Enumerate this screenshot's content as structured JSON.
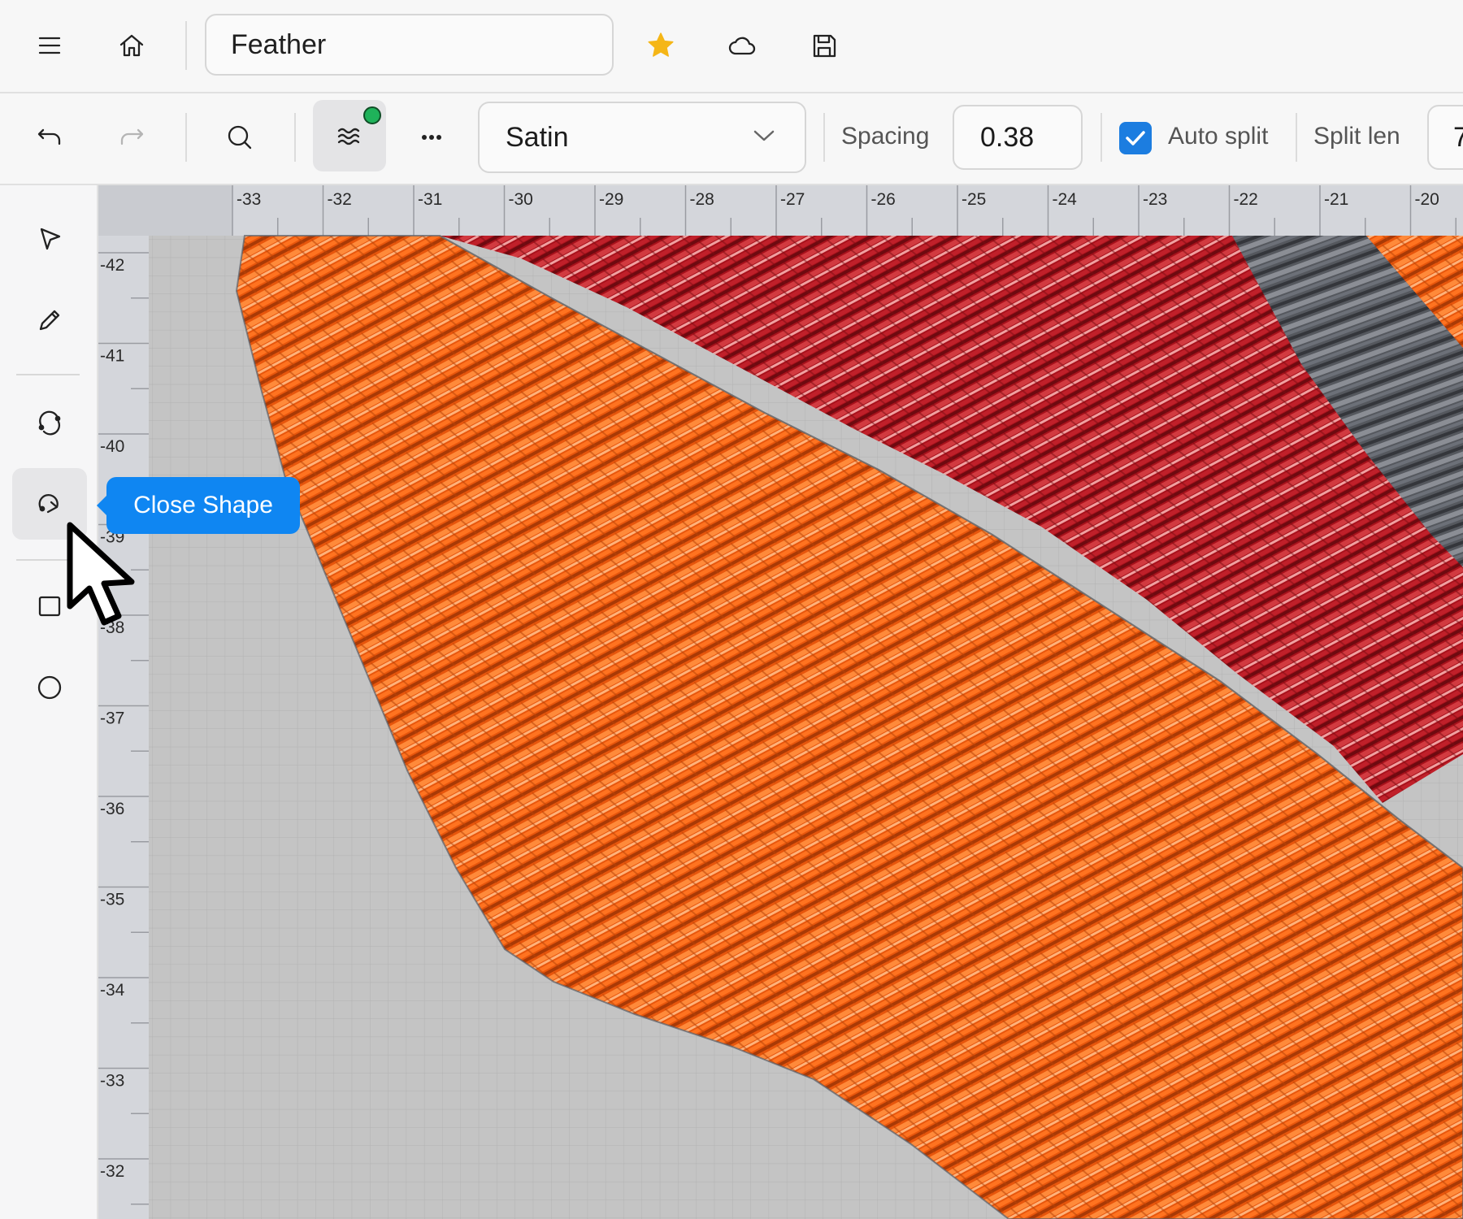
{
  "header": {
    "document_name": "Feather",
    "icons": [
      "menu-icon",
      "home-icon",
      "star-icon",
      "cloud-icon",
      "save-icon"
    ],
    "accent_star": "#f5b617"
  },
  "toolbar": {
    "stitch_type": "Satin",
    "spacing_label": "Spacing",
    "spacing_value": "0.38",
    "auto_split_label": "Auto split",
    "auto_split_checked": true,
    "split_len_label": "Split len",
    "split_len_value": "7",
    "accent": "#1c7de0",
    "status_dot": "#1fb25a"
  },
  "tools": [
    "select",
    "pen",
    "curve",
    "close-shape",
    "rectangle",
    "ellipse"
  ],
  "tooltip": {
    "text": "Close Shape",
    "color": "#0f86f2"
  },
  "rulers": {
    "top": [
      "-33",
      "-32",
      "-31",
      "-30",
      "-29",
      "-28",
      "-27",
      "-26",
      "-25",
      "-24",
      "-23",
      "-22",
      "-21",
      "-20"
    ],
    "left": [
      "-42",
      "-41",
      "-40",
      "-39",
      "-38",
      "-37",
      "-36",
      "-35",
      "-34",
      "-33",
      "-32"
    ]
  },
  "colors": {
    "orange_thread": "#f06010",
    "red_thread": "#b0141e",
    "grey_thread": "#5d6068",
    "canvas_bg": "#c3c3c3"
  }
}
